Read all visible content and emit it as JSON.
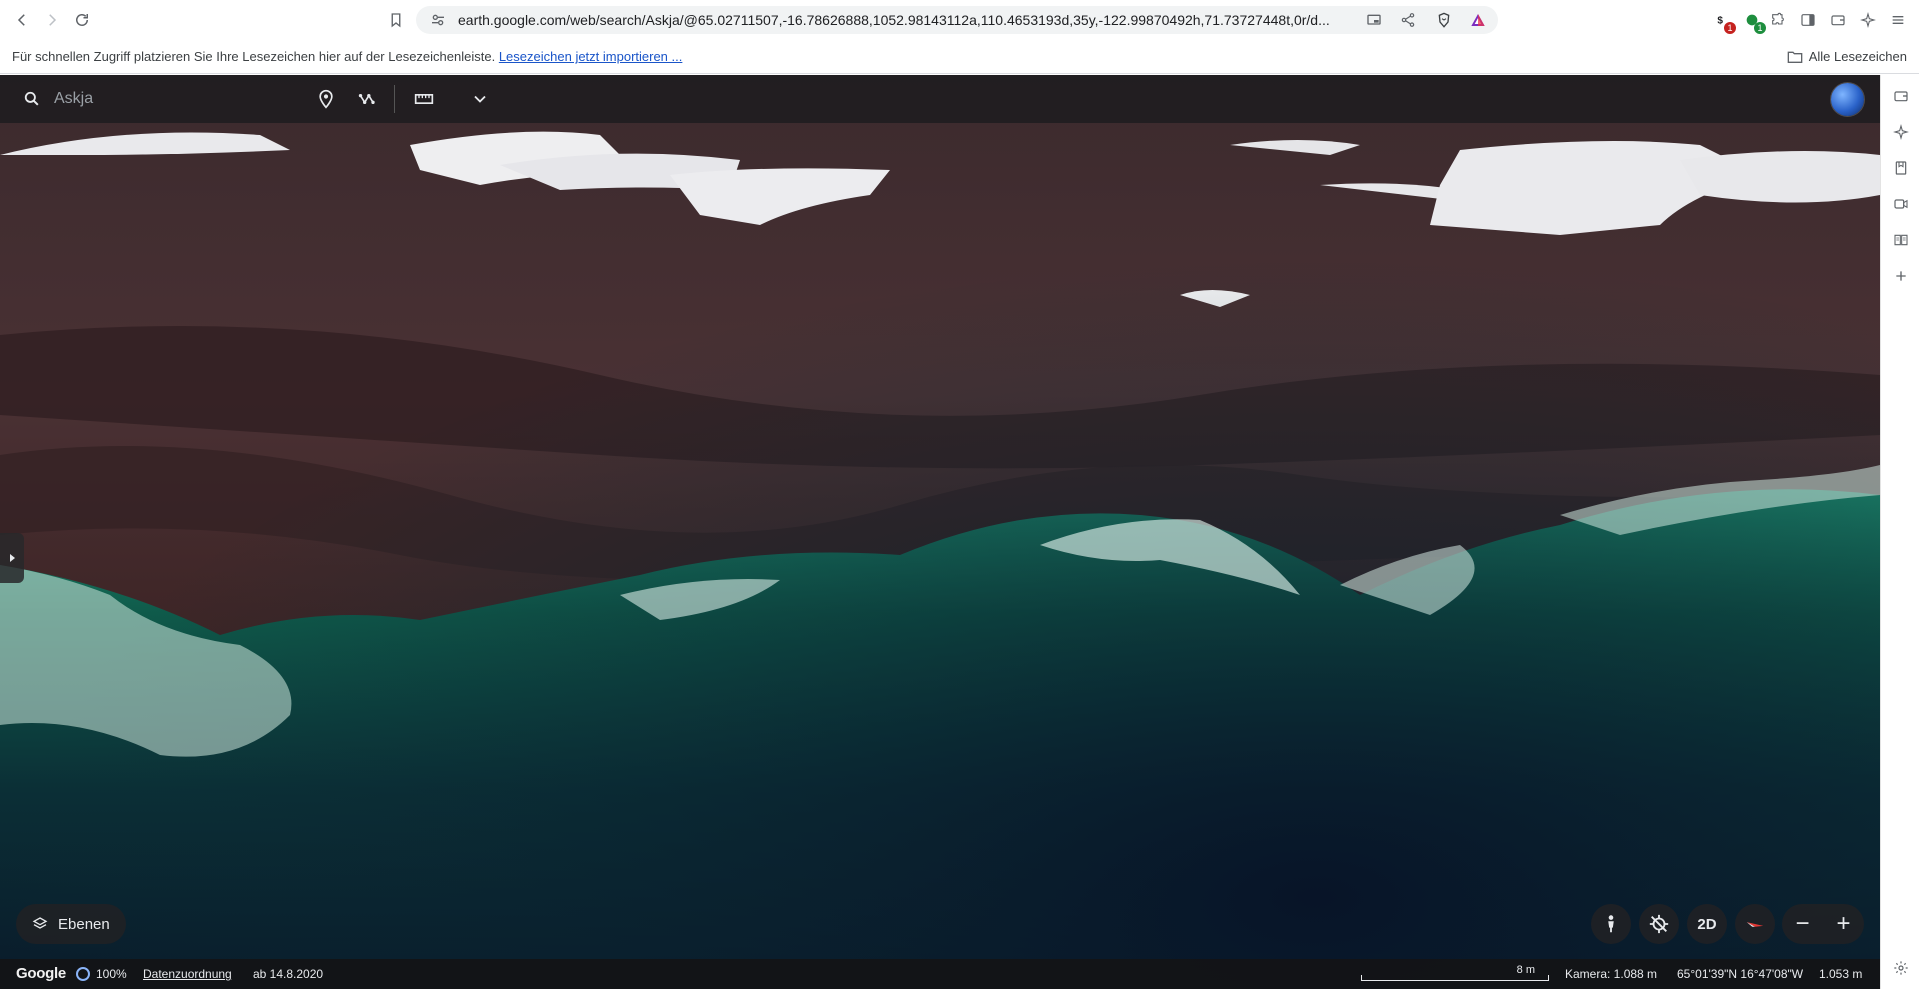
{
  "browser": {
    "url": "earth.google.com/web/search/Askja/@65.02711507,-16.78626888,1052.98143112a,110.4653193d,35y,-122.99870492h,71.73727448t,0r/d...",
    "ext_badge_1": "1",
    "ext_badge_2": "1",
    "colors": {
      "badge_red": "#c5221f",
      "badge_green": "#1e8e3e",
      "link": "#1a55c9"
    }
  },
  "bookmarks": {
    "hint_text": "Für schnellen Zugriff platzieren Sie Ihre Lesezeichen hier auf der Lesezeichenleiste.",
    "import_link": "Lesezeichen jetzt importieren ...",
    "all_bookmarks": "Alle Lesezeichen"
  },
  "earth": {
    "search": {
      "value": "",
      "placeholder": "Askja"
    },
    "layers_label": "Ebenen",
    "mode_2d_label": "2D",
    "zoom_in_label": "+",
    "zoom_out_label": "−",
    "status": {
      "logo": "Google",
      "zoom": "100%",
      "attribution": "Datenzuordnung",
      "date": "ab 14.8.2020",
      "scale": "8 m",
      "camera": "Kamera: 1.088 m",
      "coords": "65°01'39\"N 16°47'08\"W",
      "altitude": "1.053 m"
    }
  }
}
